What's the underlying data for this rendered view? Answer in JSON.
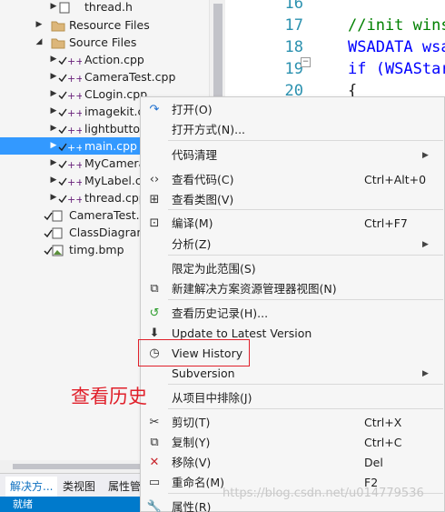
{
  "solution_tree": {
    "items": [
      {
        "label": "thread.h",
        "type": "header-file",
        "expander": "▶",
        "selected": false
      },
      {
        "label": "Resource Files",
        "type": "folder",
        "expander": "▶",
        "selected": false
      },
      {
        "label": "Source Files",
        "type": "folder-open",
        "expander": "◢",
        "selected": false
      },
      {
        "label": "Action.cpp",
        "type": "cpp-file",
        "expander": "▶",
        "selected": false
      },
      {
        "label": "CameraTest.cpp",
        "type": "cpp-file",
        "expander": "▶",
        "selected": false
      },
      {
        "label": "CLogin.cpp",
        "type": "cpp-file",
        "expander": "▶",
        "selected": false
      },
      {
        "label": "imagekit.c",
        "type": "cpp-file",
        "expander": "▶",
        "selected": false
      },
      {
        "label": "lightbuttor",
        "type": "cpp-file",
        "expander": "▶",
        "selected": false
      },
      {
        "label": "main.cpp",
        "type": "cpp-file",
        "expander": "▶",
        "selected": true
      },
      {
        "label": "MyCamera",
        "type": "cpp-file",
        "expander": "▶",
        "selected": false
      },
      {
        "label": "MyLabel.cp",
        "type": "cpp-file",
        "expander": "▶",
        "selected": false
      },
      {
        "label": "thread.cpp",
        "type": "cpp-file",
        "expander": "▶",
        "selected": false
      },
      {
        "label": "CameraTest.r",
        "type": "resource-file",
        "expander": "",
        "selected": false
      },
      {
        "label": "ClassDiagram",
        "type": "diagram-file",
        "expander": "",
        "selected": false
      },
      {
        "label": "timg.bmp",
        "type": "image-file",
        "expander": "",
        "selected": false
      }
    ]
  },
  "bottom_tabs": [
    "解决方...",
    "类视图",
    "属性管"
  ],
  "status_text": "就绪",
  "editor": {
    "lines": [
      {
        "num": "16",
        "code": "",
        "cls": ""
      },
      {
        "num": "17",
        "code": "//init wins",
        "cls": "cmt"
      },
      {
        "num": "18",
        "code": "WSADATA wsa",
        "cls": "kw"
      },
      {
        "num": "19",
        "code": "if (WSAStar",
        "cls": "kw"
      },
      {
        "num": "20",
        "code": "{",
        "cls": ""
      }
    ]
  },
  "context_menu": {
    "items": [
      {
        "label": "打开(O)",
        "shortcut": "",
        "submenu": false,
        "icon": "open-icon",
        "glyph": "↷",
        "color": "#1e6fcf"
      },
      {
        "label": "打开方式(N)...",
        "shortcut": "",
        "submenu": false,
        "icon": "",
        "glyph": "",
        "color": ""
      },
      {
        "label": "代码清理",
        "shortcut": "",
        "submenu": true,
        "icon": "",
        "glyph": "",
        "color": ""
      },
      {
        "label": "查看代码(C)",
        "shortcut": "Ctrl+Alt+0",
        "submenu": false,
        "icon": "view-code-icon",
        "glyph": "‹›",
        "color": "#333333"
      },
      {
        "label": "查看类图(V)",
        "shortcut": "",
        "submenu": false,
        "icon": "class-diagram-icon",
        "glyph": "⊞",
        "color": "#333333"
      },
      {
        "label": "编译(M)",
        "shortcut": "Ctrl+F7",
        "submenu": false,
        "icon": "compile-icon",
        "glyph": "⊡",
        "color": "#333333"
      },
      {
        "label": "分析(Z)",
        "shortcut": "",
        "submenu": true,
        "icon": "",
        "glyph": "",
        "color": ""
      },
      {
        "label": "限定为此范围(S)",
        "shortcut": "",
        "submenu": false,
        "icon": "",
        "glyph": "",
        "color": ""
      },
      {
        "label": "新建解决方案资源管理器视图(N)",
        "shortcut": "",
        "submenu": false,
        "icon": "new-view-icon",
        "glyph": "⧉",
        "color": "#333333"
      },
      {
        "label": "查看历史记录(H)...",
        "shortcut": "",
        "submenu": false,
        "icon": "history-icon",
        "glyph": "↺",
        "color": "#2f9e2f"
      },
      {
        "label": "Update to Latest Version",
        "shortcut": "",
        "submenu": false,
        "icon": "update-icon",
        "glyph": "⬇",
        "color": "#333333"
      },
      {
        "label": "View History",
        "shortcut": "",
        "submenu": false,
        "icon": "clock-icon",
        "glyph": "◷",
        "color": "#333333"
      },
      {
        "label": "Subversion",
        "shortcut": "",
        "submenu": true,
        "icon": "",
        "glyph": "",
        "color": ""
      },
      {
        "label": "从项目中排除(J)",
        "shortcut": "",
        "submenu": false,
        "icon": "",
        "glyph": "",
        "color": ""
      },
      {
        "label": "剪切(T)",
        "shortcut": "Ctrl+X",
        "submenu": false,
        "icon": "cut-icon",
        "glyph": "✂",
        "color": "#333333"
      },
      {
        "label": "复制(Y)",
        "shortcut": "Ctrl+C",
        "submenu": false,
        "icon": "copy-icon",
        "glyph": "⧉",
        "color": "#333333"
      },
      {
        "label": "移除(V)",
        "shortcut": "Del",
        "submenu": false,
        "icon": "remove-icon",
        "glyph": "✕",
        "color": "#c8262d"
      },
      {
        "label": "重命名(M)",
        "shortcut": "F2",
        "submenu": false,
        "icon": "rename-icon",
        "glyph": "▭",
        "color": "#333333"
      },
      {
        "label": "属性(R)",
        "shortcut": "",
        "submenu": false,
        "icon": "wrench-icon",
        "glyph": "🔧",
        "color": "#333333"
      }
    ]
  },
  "annotation": "查看历史",
  "watermark": "https://blog.csdn.net/u014779536",
  "colors": {
    "accent": "#007acc",
    "selection": "#3399ff",
    "highlight": "#e0202a"
  }
}
